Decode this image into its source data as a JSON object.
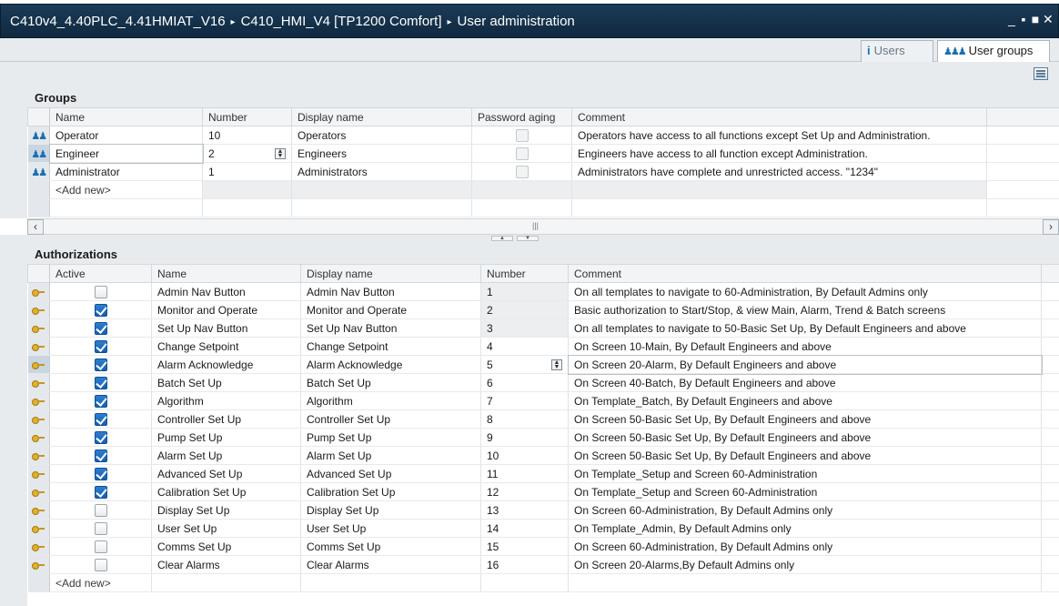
{
  "titlebar": {
    "crumbs": [
      "C410v4_4.40PLC_4.41HMIAT_V16",
      "C410_HMI_V4 [TP1200 Comfort]",
      "User administration"
    ],
    "separator": "▸",
    "controls": [
      "_",
      "▪",
      "■",
      "✕"
    ]
  },
  "tabs": [
    {
      "label": "Users",
      "icon": "user-icon",
      "active": false
    },
    {
      "label": "User groups",
      "icon": "user-group-icon",
      "active": true
    }
  ],
  "groups": {
    "title": "Groups",
    "columns": [
      "Name",
      "Number",
      "Display name",
      "Password aging",
      "Comment"
    ],
    "rows": [
      {
        "name": "Operator",
        "number": "10",
        "display": "Operators",
        "aging": false,
        "comment": "Operators have access to all functions except Set Up and Administration."
      },
      {
        "name": "Engineer",
        "number": "2",
        "display": "Engineers",
        "aging": false,
        "comment": "Engineers have access to all function except Administration."
      },
      {
        "name": "Administrator",
        "number": "1",
        "display": "Administrators",
        "aging": false,
        "comment": "Administrators have complete and unrestricted access. \"1234\""
      }
    ],
    "add_new": "<Add new>"
  },
  "authorizations": {
    "title": "Authorizations",
    "columns": [
      "Active",
      "Name",
      "Display name",
      "Number",
      "Comment"
    ],
    "rows": [
      {
        "active": false,
        "name": "Admin Nav Button",
        "display": "Admin Nav Button",
        "number": "1",
        "comment": "On all templates to navigate to 60-Administration, By Default Admins only"
      },
      {
        "active": true,
        "name": "Monitor and Operate",
        "display": "Monitor and Operate",
        "number": "2",
        "comment": "Basic authorization to Start/Stop, & view Main, Alarm, Trend & Batch screens"
      },
      {
        "active": true,
        "name": "Set Up Nav Button",
        "display": "Set Up Nav Button",
        "number": "3",
        "comment": "On all templates to navigate to 50-Basic Set Up,  By Default Engineers and above"
      },
      {
        "active": true,
        "name": "Change Setpoint",
        "display": "Change Setpoint",
        "number": "4",
        "comment": "On Screen 10-Main, By Default Engineers and above"
      },
      {
        "active": true,
        "name": "Alarm Acknowledge",
        "display": "Alarm Acknowledge",
        "number": "5",
        "comment": "On Screen 20-Alarm, By Default Engineers and above"
      },
      {
        "active": true,
        "name": "Batch Set Up",
        "display": "Batch Set Up",
        "number": "6",
        "comment": "On Screen 40-Batch, By Default Engineers and above"
      },
      {
        "active": true,
        "name": "Algorithm",
        "display": "Algorithm",
        "number": "7",
        "comment": "On Template_Batch, By Default Engineers and above"
      },
      {
        "active": true,
        "name": "Controller Set Up",
        "display": "Controller Set Up",
        "number": "8",
        "comment": "On Screen 50-Basic Set Up, By Default Engineers and above"
      },
      {
        "active": true,
        "name": "Pump Set Up",
        "display": "Pump Set Up",
        "number": "9",
        "comment": "On Screen 50-Basic Set Up, By Default Engineers and above"
      },
      {
        "active": true,
        "name": "Alarm Set Up",
        "display": "Alarm Set Up",
        "number": "10",
        "comment": "On Screen 50-Basic Set Up, By Default Engineers and above"
      },
      {
        "active": true,
        "name": "Advanced Set Up",
        "display": "Advanced Set Up",
        "number": "11",
        "comment": "On Template_Setup and Screen 60-Administration"
      },
      {
        "active": true,
        "name": "Calibration Set Up",
        "display": "Calibration Set Up",
        "number": "12",
        "comment": "On Template_Setup and Screen 60-Administration"
      },
      {
        "active": false,
        "name": "Display Set Up",
        "display": "Display Set Up",
        "number": "13",
        "comment": "On Screen 60-Administration, By Default Admins only"
      },
      {
        "active": false,
        "name": "User Set Up",
        "display": "User Set Up",
        "number": "14",
        "comment": "On Template_Admin, By Default Admins only"
      },
      {
        "active": false,
        "name": "Comms Set Up",
        "display": "Comms Set Up",
        "number": "15",
        "comment": "On Screen 60-Administration, By Default Admins only"
      },
      {
        "active": false,
        "name": "Clear Alarms",
        "display": "Clear Alarms",
        "number": "16",
        "comment": "On Screen 20-Alarms,By Default Admins only"
      }
    ],
    "add_new": "<Add new>"
  },
  "colors": {
    "title_bg": "#0f2940",
    "accent": "#1560b0",
    "panel": "#e8ebee"
  }
}
